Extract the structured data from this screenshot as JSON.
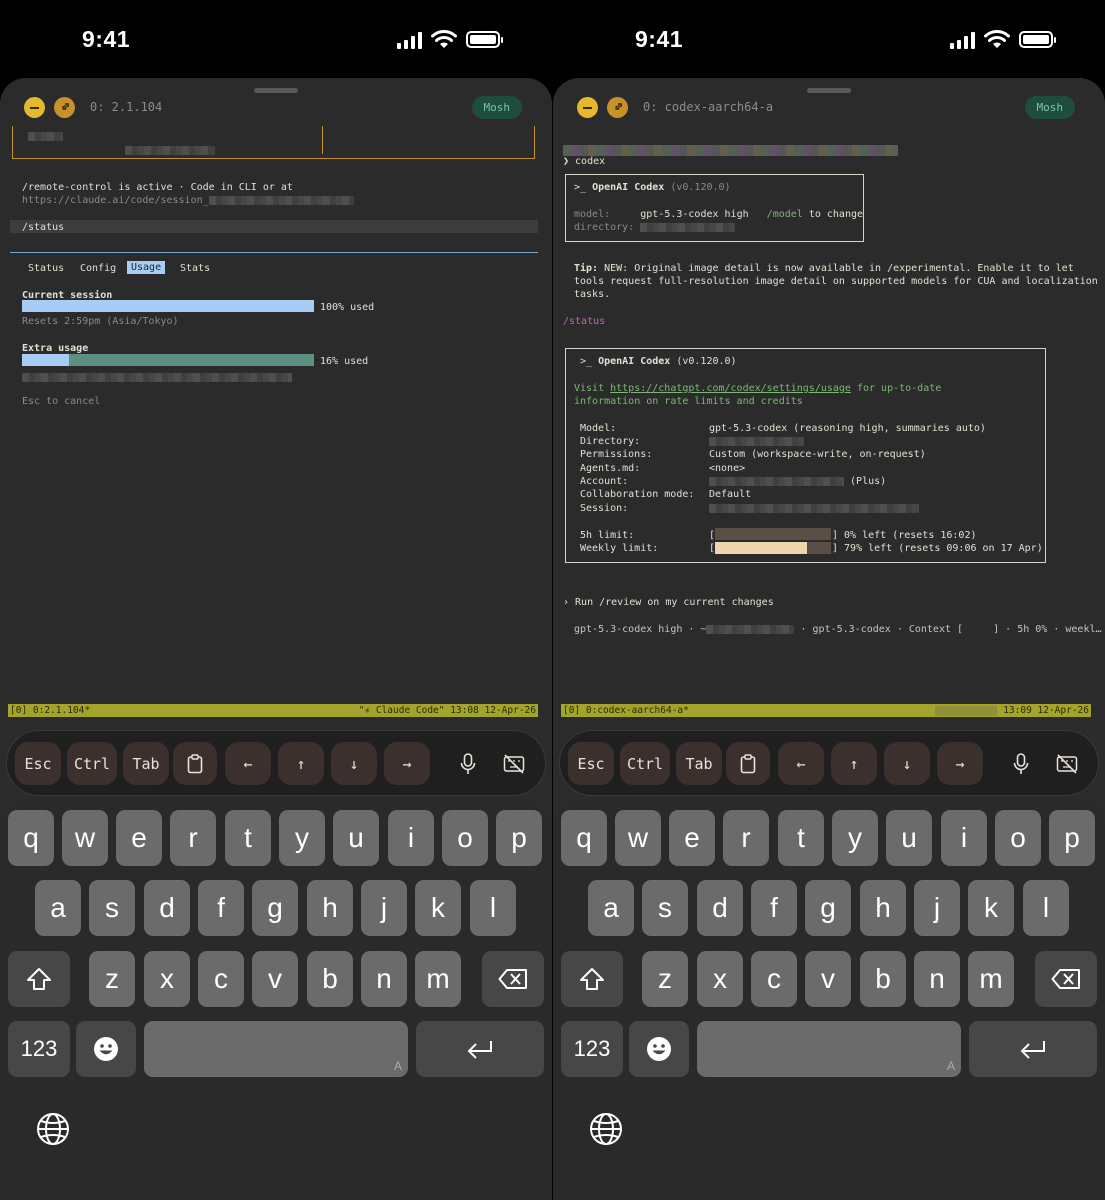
{
  "status_bar": {
    "time": "9:41"
  },
  "left": {
    "session_title": "0: 2.1.104",
    "transport_badge": "Mosh",
    "lines": {
      "remote_control": "/remote-control is active · Code in CLI or at",
      "session_url": "https://claude.ai/code/session_",
      "command": "/status"
    },
    "tabs": [
      "Status",
      "Config",
      "Usage",
      "Stats"
    ],
    "active_tab": "Usage",
    "usage": {
      "current_session_label": "Current session",
      "current_session_fraction": 1.0,
      "current_session_text": "100% used",
      "resets_text": "Resets 2:59pm (Asia/Tokyo)",
      "extra_usage_label": "Extra usage",
      "extra_usage_fraction": 0.16,
      "extra_usage_text": "16% used",
      "cancel_hint": "Esc to cancel"
    },
    "tmux": {
      "left": "[0] 0:2.1.104*",
      "right": "\"✳ Claude Code\" 13:08 12-Apr-26"
    }
  },
  "right": {
    "session_title": "0: codex-aarch64-a",
    "transport_badge": "Mosh",
    "prompt_line": "❯ codex",
    "header_box": {
      "title_prefix": ">_ ",
      "title": "OpenAI Codex",
      "version": "(v0.120.0)",
      "model_label": "model:",
      "model_value": "gpt-5.3-codex high",
      "model_hint_cmd": "/model",
      "model_hint_text": " to change",
      "directory_label": "directory:"
    },
    "tip": {
      "label": "Tip:",
      "line1": " NEW: Original image detail is now available in /experimental. Enable it to let",
      "line2": "tools request full-resolution image detail on supported models for CUA and localization",
      "line3": "tasks."
    },
    "status_cmd": "/status",
    "status_box": {
      "title_prefix": ">_ ",
      "title": "OpenAI Codex",
      "version": "(v0.120.0)",
      "visit_prefix": "Visit ",
      "visit_url": "https://chatgpt.com/codex/settings/usage",
      "visit_suffix": " for up-to-date",
      "visit_line2": "information on rate limits and credits",
      "rows": [
        {
          "label": "Model:",
          "value": "gpt-5.3-codex (reasoning high, summaries auto)"
        },
        {
          "label": "Directory:",
          "value": ""
        },
        {
          "label": "Permissions:",
          "value": "Custom (workspace-write, on-request)"
        },
        {
          "label": "Agents.md:",
          "value": "<none>"
        },
        {
          "label": "Account:",
          "value": "(Plus)"
        },
        {
          "label": "Collaboration mode:",
          "value": "Default"
        },
        {
          "label": "Session:",
          "value": ""
        }
      ],
      "limits": [
        {
          "label": "5h limit:",
          "fraction_left": 0.0,
          "text": "] 0% left (resets 16:02)"
        },
        {
          "label": "Weekly limit:",
          "fraction_left": 0.79,
          "text": "] 79% left (resets 09:06 on 17 Apr)"
        }
      ]
    },
    "suggestion": "› Run /review on my current changes",
    "footer": {
      "model": "gpt-5.3-codex high · ~",
      "rest": "· gpt-5.3-codex · Context [     ] · 5h 0% · weekl…"
    },
    "tmux": {
      "left": "[0] 0:codex-aarch64-a*",
      "right": "13:09 12-Apr-26"
    }
  },
  "toolbar": {
    "esc": "Esc",
    "ctrl": "Ctrl",
    "tab": "Tab",
    "arrow_left": "←",
    "arrow_up": "↑",
    "arrow_down": "↓",
    "arrow_right": "→"
  },
  "keyboard": {
    "row1": [
      "q",
      "w",
      "e",
      "r",
      "t",
      "y",
      "u",
      "i",
      "o",
      "p"
    ],
    "row2": [
      "a",
      "s",
      "d",
      "f",
      "g",
      "h",
      "j",
      "k",
      "l"
    ],
    "row3": [
      "z",
      "x",
      "c",
      "v",
      "b",
      "n",
      "m"
    ],
    "numbers_key": "123",
    "space_mark": "A"
  },
  "colors": {
    "sheet_bg": "#2b2b2b",
    "usage_bar": "#a8cdf4",
    "extra_bar": "#5e8f83",
    "weekly_bar": "#efd6aa",
    "tmux_bar": "#a3a42b",
    "accent_orange": "#c8922a"
  }
}
